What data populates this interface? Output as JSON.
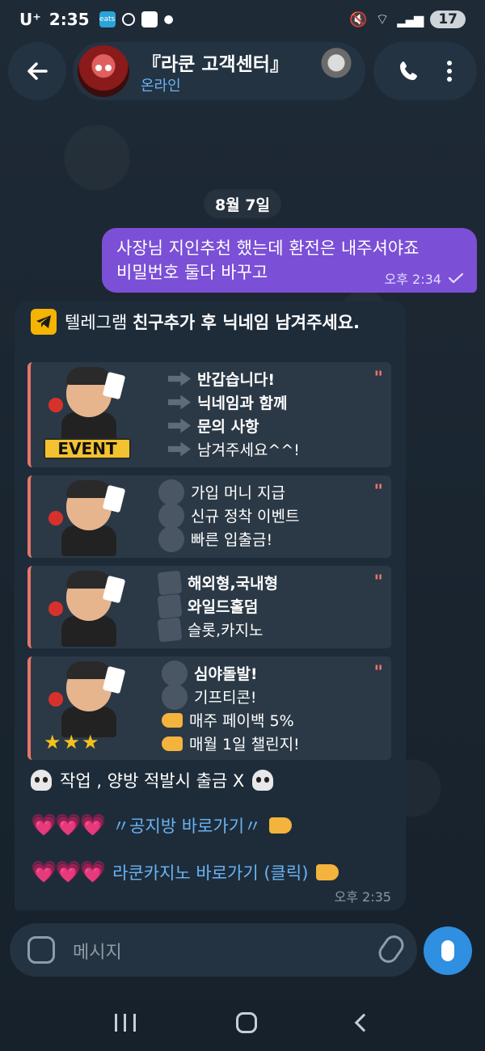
{
  "status_bar": {
    "carrier": "U⁺",
    "time": "2:35",
    "eats_label": "eats",
    "battery": "17"
  },
  "header": {
    "title": "『라쿤 고객센터』",
    "status": "온라인"
  },
  "date_chip": "8월 7일",
  "outgoing": {
    "line1": "사장님 지인추천 했는데 환전은 내주셔야죠",
    "line2": "비밀번호 둘다 바꾸고",
    "time": "오후 2:34"
  },
  "incoming": {
    "intro_plain": "텔레그램 ",
    "intro_bold": "친구추가 후 닉네임 남겨주세요.",
    "promo1": {
      "badge": "EVENT",
      "lines": [
        "반갑습니다!",
        "닉네임과 함께",
        "문의 사항",
        "남겨주세요^^!"
      ]
    },
    "promo2": {
      "lines": [
        "가입 머니 지급",
        "신규 정착 이벤트",
        "빠른 입출금!"
      ]
    },
    "promo3": {
      "lines": [
        "해외형,국내형",
        "와일드홀덤",
        "슬롯,카지노"
      ]
    },
    "promo4": {
      "lines": [
        "심야돌발!",
        "기프티콘!",
        "매주 페이백 5%",
        "매월 1일 챌린지!"
      ]
    },
    "quote_mark": "\"",
    "warning": "작업 , 양방 적발시 출금 X",
    "link1": "〃공지방 바로가기〃",
    "link2": "라쿤카지노 바로가기 (클릭)",
    "hearts": "💗💗💗",
    "stars": "★★★",
    "time": "오후 2:35"
  },
  "input": {
    "placeholder": "메시지"
  }
}
